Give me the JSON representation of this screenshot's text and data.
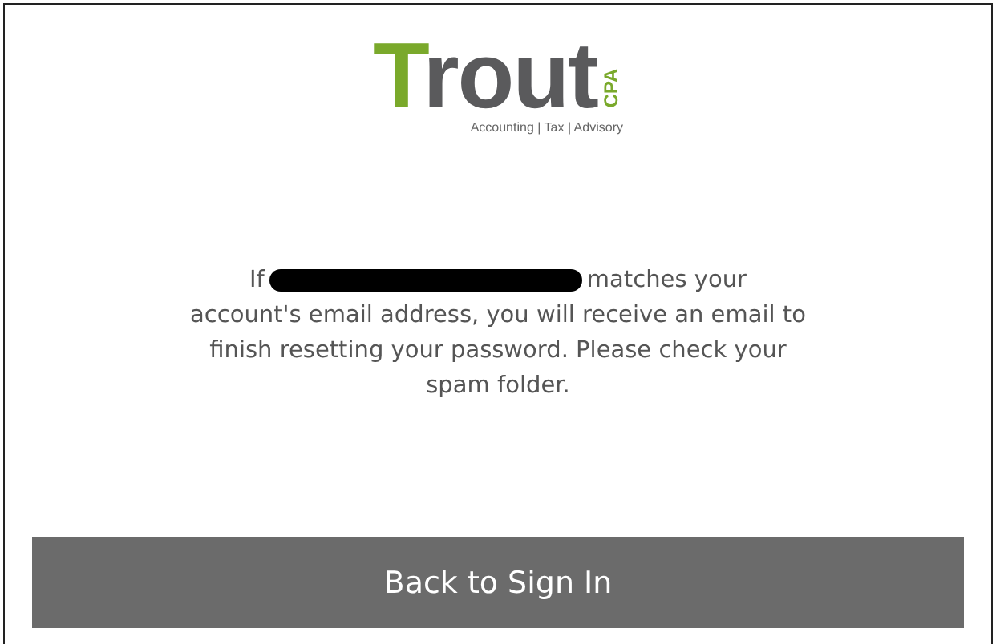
{
  "logo": {
    "wordmark": "Trout",
    "badge": "CPA",
    "tagline": "Accounting | Tax | Advisory"
  },
  "message": {
    "lead": "If",
    "redacted": true,
    "after": "matches your",
    "rest": "account's email address, you will receive an email to finish resetting your password. Please check your spam folder."
  },
  "button": {
    "label": "Back to Sign In"
  }
}
